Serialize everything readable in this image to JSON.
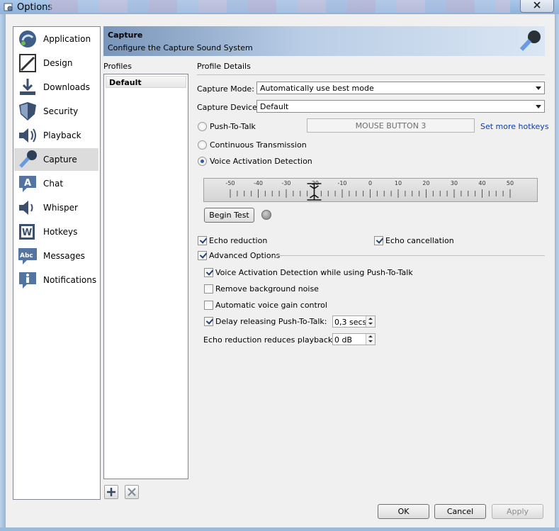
{
  "window": {
    "title": "Options"
  },
  "nav": {
    "items": [
      {
        "label": "Application",
        "icon": "application-icon"
      },
      {
        "label": "Design",
        "icon": "design-icon"
      },
      {
        "label": "Downloads",
        "icon": "download-icon"
      },
      {
        "label": "Security",
        "icon": "shield-icon"
      },
      {
        "label": "Playback",
        "icon": "speaker-icon"
      },
      {
        "label": "Capture",
        "icon": "microphone-icon",
        "active": true
      },
      {
        "label": "Chat",
        "icon": "chat-icon"
      },
      {
        "label": "Whisper",
        "icon": "whisper-icon"
      },
      {
        "label": "Hotkeys",
        "icon": "hotkeys-icon"
      },
      {
        "label": "Messages",
        "icon": "messages-icon"
      },
      {
        "label": "Notifications",
        "icon": "info-icon"
      }
    ]
  },
  "header": {
    "title": "Capture",
    "subtitle": "Configure the Capture Sound System"
  },
  "profiles": {
    "label": "Profiles",
    "items": [
      "Default"
    ],
    "selected": "Default"
  },
  "details": {
    "label": "Profile Details",
    "capture_mode": {
      "label": "Capture Mode:",
      "value": "Automatically use best mode"
    },
    "capture_device": {
      "label": "Capture Device:",
      "value": "Default"
    },
    "mode": {
      "push_to_talk": {
        "label": "Push-To-Talk",
        "checked": false
      },
      "continuous": {
        "label": "Continuous Transmission",
        "checked": false
      },
      "vad": {
        "label": "Voice Activation Detection",
        "checked": true
      }
    },
    "hotkey": {
      "value": "MOUSE BUTTON 3"
    },
    "set_hotkeys_link": "Set more hotkeys",
    "vad_slider": {
      "ticks": [
        "-50",
        "-40",
        "-30",
        "-20",
        "-10",
        "0",
        "10",
        "20",
        "30",
        "40",
        "50"
      ],
      "value": -20
    },
    "begin_test": "Begin Test",
    "echo_reduction": {
      "label": "Echo reduction",
      "checked": true
    },
    "echo_cancellation": {
      "label": "Echo cancellation",
      "checked": true
    },
    "advanced_options": {
      "label": "Advanced Options",
      "checked": true
    },
    "vad_with_ptt": {
      "label": "Voice Activation Detection while using Push-To-Talk",
      "checked": true
    },
    "remove_noise": {
      "label": "Remove background noise",
      "checked": false
    },
    "auto_gain": {
      "label": "Automatic voice gain control",
      "checked": false
    },
    "delay_ptt": {
      "label": "Delay releasing Push-To-Talk:",
      "checked": true,
      "value": "0,3 secs"
    },
    "echo_reduces": {
      "label": "Echo reduction reduces playback by:",
      "value": "0 dB"
    }
  },
  "footer": {
    "ok": "OK",
    "cancel": "Cancel",
    "apply": "Apply"
  },
  "colors": {
    "accent": "#2a5caa",
    "link": "#0b3ca8",
    "header_start": "#7995b9",
    "header_end": "#dae6f3"
  }
}
